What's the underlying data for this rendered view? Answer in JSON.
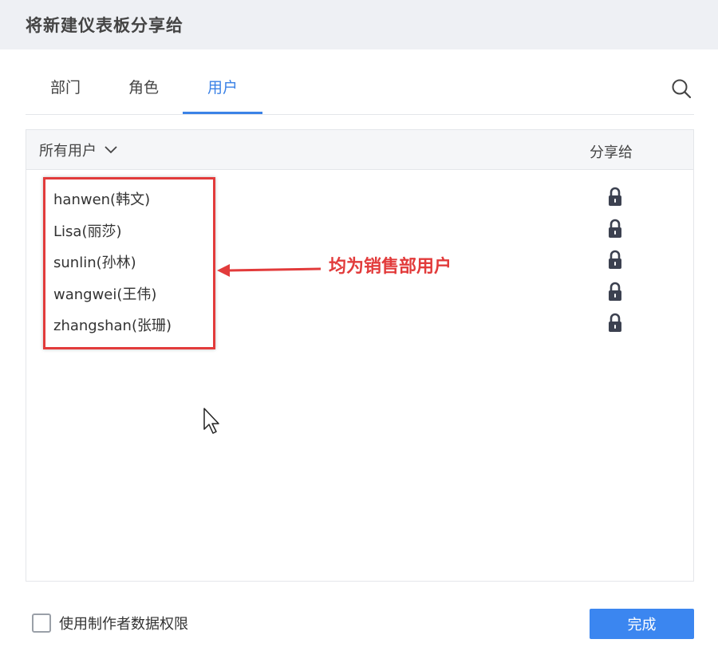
{
  "dialog": {
    "title": "将新建仪表板分享给"
  },
  "tabs": [
    {
      "label": "部门",
      "active": false
    },
    {
      "label": "角色",
      "active": false
    },
    {
      "label": "用户",
      "active": true
    }
  ],
  "list": {
    "filter_label": "所有用户",
    "share_column_label": "分享给",
    "users": [
      {
        "name": "hanwen(韩文)",
        "share_icon": "lock-icon"
      },
      {
        "name": "Lisa(丽莎)",
        "share_icon": "lock-icon"
      },
      {
        "name": "sunlin(孙林)",
        "share_icon": "lock-icon"
      },
      {
        "name": "wangwei(王伟)",
        "share_icon": "lock-icon"
      },
      {
        "name": "zhangshan(张珊)",
        "share_icon": "lock-icon"
      }
    ]
  },
  "annotation": {
    "text": "均为销售部用户",
    "color": "#e23b3b"
  },
  "footer": {
    "checkbox_label": "使用制作者数据权限",
    "checkbox_checked": false,
    "done_label": "完成"
  },
  "colors": {
    "accent": "#3b82e6",
    "button": "#3b86f0",
    "annotation": "#e23b3b"
  }
}
